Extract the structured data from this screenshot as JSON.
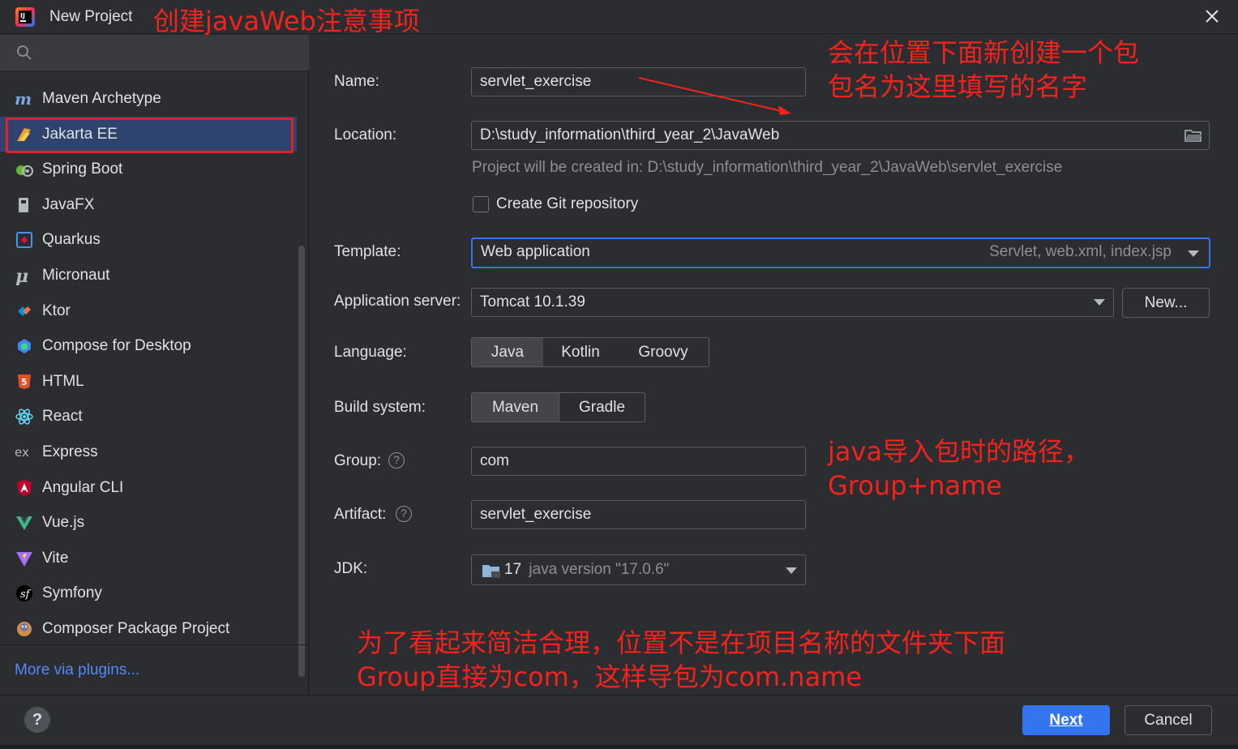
{
  "window": {
    "title": "New Project"
  },
  "search": {
    "placeholder": ""
  },
  "generators": [
    {
      "label": "Maven Archetype",
      "icon": "maven-icon"
    },
    {
      "label": "Jakarta EE",
      "icon": "jakarta-ee-icon",
      "selected": true
    },
    {
      "label": "Spring Boot",
      "icon": "spring-boot-icon"
    },
    {
      "label": "JavaFX",
      "icon": "javafx-icon"
    },
    {
      "label": "Quarkus",
      "icon": "quarkus-icon"
    },
    {
      "label": "Micronaut",
      "icon": "micronaut-icon"
    },
    {
      "label": "Ktor",
      "icon": "ktor-icon"
    },
    {
      "label": "Compose for Desktop",
      "icon": "compose-icon"
    },
    {
      "label": "HTML",
      "icon": "html5-icon"
    },
    {
      "label": "React",
      "icon": "react-icon"
    },
    {
      "label": "Express",
      "icon": "express-icon"
    },
    {
      "label": "Angular CLI",
      "icon": "angular-icon"
    },
    {
      "label": "Vue.js",
      "icon": "vue-icon"
    },
    {
      "label": "Vite",
      "icon": "vite-icon"
    },
    {
      "label": "Symfony",
      "icon": "symfony-icon"
    },
    {
      "label": "Composer Package Project",
      "icon": "composer-icon"
    }
  ],
  "sidebar": {
    "more_plugins": "More via plugins..."
  },
  "form": {
    "name_label": "Name:",
    "name_value": "servlet_exercise",
    "location_label": "Location:",
    "location_value": "D:\\study_information\\third_year_2\\JavaWeb",
    "location_hint": "Project will be created in: D:\\study_information\\third_year_2\\JavaWeb\\servlet_exercise",
    "git_label": "Create Git repository",
    "git_checked": false,
    "template_label": "Template:",
    "template_value": "Web application",
    "template_hint": "Servlet, web.xml, index.jsp",
    "server_label": "Application server:",
    "server_value": "Tomcat 10.1.39",
    "server_new_button": "New...",
    "language_label": "Language:",
    "languages": [
      "Java",
      "Kotlin",
      "Groovy"
    ],
    "language_selected": "Java",
    "build_label": "Build system:",
    "build_systems": [
      "Maven",
      "Gradle"
    ],
    "build_selected": "Maven",
    "group_label": "Group:",
    "group_value": "com",
    "artifact_label": "Artifact:",
    "artifact_value": "servlet_exercise",
    "jdk_label": "JDK:",
    "jdk_version": "17",
    "jdk_detail": "java version \"17.0.6\""
  },
  "footer": {
    "help": "?",
    "next": "Next",
    "cancel": "Cancel"
  },
  "annotations": {
    "title": "创建javaWeb注意事项",
    "name_note_1": "会在位置下面新创建一个包",
    "name_note_2": "包名为这里填写的名字",
    "group_note_1": "java导入包时的路径，",
    "group_note_2": "Group+name",
    "bottom_note_1": "为了看起来简洁合理，位置不是在项目名称的文件夹下面",
    "bottom_note_2": "Group直接为com，这样导包为com.name"
  },
  "colors": {
    "accent": "#3574f0",
    "selection": "#2e436e",
    "annotation": "#f2231d",
    "background": "#2b2d30"
  }
}
